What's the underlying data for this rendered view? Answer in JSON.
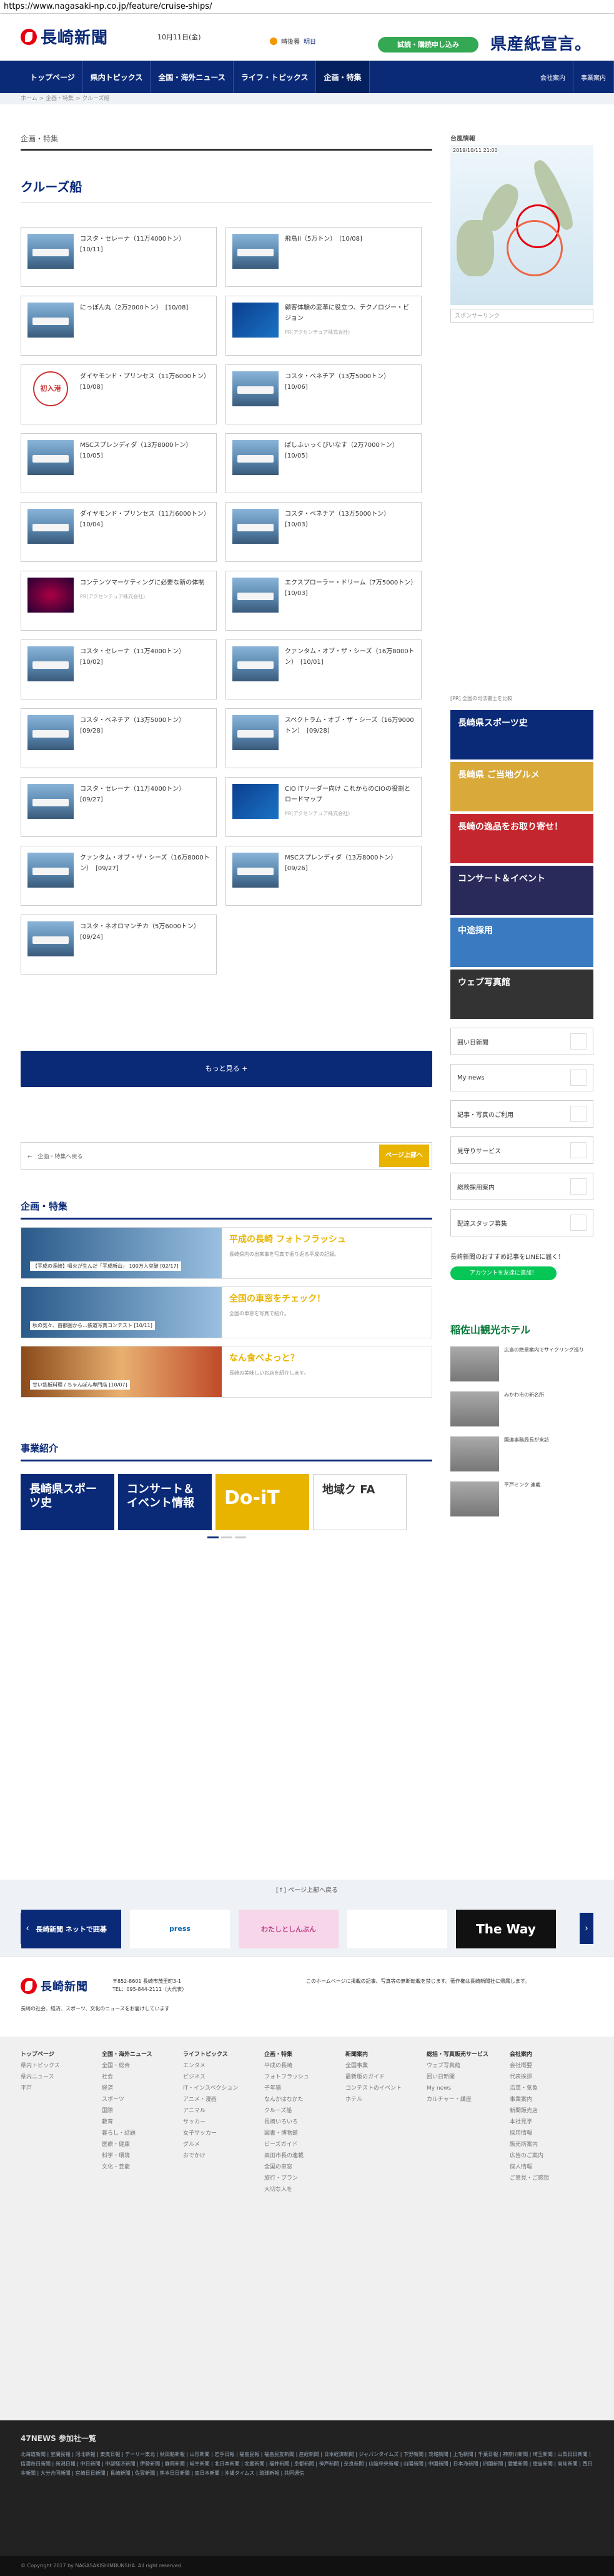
{
  "browser": {
    "url": "https://www.nagasaki-np.co.jp/feature/cruise-ships/"
  },
  "header": {
    "logo": "長崎新聞",
    "date": "10月11日(金)",
    "weather": "晴後曇",
    "weather_link": "明日",
    "trial": "試読・購読申し込み",
    "banner": "県産紙宣言。"
  },
  "nav": {
    "items": [
      "トップページ",
      "県内トピックス",
      "全国・海外ニュース",
      "ライフ・トピックス",
      "企画・特集"
    ],
    "right": [
      "会社案内",
      "事業案内"
    ]
  },
  "breadcrumb": "ホーム > 企画・特集 > クルーズ船",
  "section": "企画・特集",
  "page_title": "クルーズ船",
  "articles": [
    {
      "text": "コスタ・セレーナ（11万4000トン）　[10/11]",
      "type": "ship"
    },
    {
      "text": "飛鳥II（5万トン）　[10/08]",
      "type": "ship"
    },
    {
      "text": "にっぽん丸（2万2000トン）　[10/08]",
      "type": "ship"
    },
    {
      "text": "顧客体験の変革に役立つ、テクノロジー・ビジョン",
      "note": "PR(アクセンチュア株式会社)",
      "type": "tech"
    },
    {
      "text": "ダイヤモンド・プリンセス（11万6000トン）　[10/08]",
      "type": "badge",
      "badge": "初入港"
    },
    {
      "text": "コスタ・ベネチア（13万5000トン）　[10/06]",
      "type": "ship"
    },
    {
      "text": "MSCスプレンディダ（13万8000トン）　[10/05]",
      "type": "ship"
    },
    {
      "text": "ぱしふぃっくびいなす（2万7000トン）　[10/05]",
      "type": "ship"
    },
    {
      "text": "ダイヤモンド・プリンセス（11万6000トン）　[10/04]",
      "type": "ship"
    },
    {
      "text": "コスタ・ベネチア（13万5000トン）　[10/03]",
      "type": "ship"
    },
    {
      "text": "コンテンツマーケティングに必要な新の体制",
      "note": "PR(アクセンチュア株式会社)",
      "type": "night"
    },
    {
      "text": "エクスプローラー・ドリーム（7万5000トン）　[10/03]",
      "type": "ship"
    },
    {
      "text": "コスタ・セレーナ（11万4000トン）　[10/02]",
      "type": "ship"
    },
    {
      "text": "クァンタム・オブ・ザ・シーズ（16万8000トン）　[10/01]",
      "type": "ship"
    },
    {
      "text": "コスタ・ベネチア（13万5000トン）　[09/28]",
      "type": "ship"
    },
    {
      "text": "スペクトラム・オブ・ザ・シーズ（16万9000トン）　[09/28]",
      "type": "ship"
    },
    {
      "text": "コスタ・セレーナ（11万4000トン）　[09/27]",
      "type": "ship"
    },
    {
      "text": "CIO ITリーダー向け これからのCIOの役割とロードマップ",
      "note": "PR(アクセンチュア株式会社)",
      "type": "tech"
    },
    {
      "text": "クァンタム・オブ・ザ・シーズ（16万8000トン）　[09/27]",
      "type": "ship"
    },
    {
      "text": "MSCスプレンディダ（13万8000トン）　[09/26]",
      "type": "ship"
    },
    {
      "text": "コスタ・ネオロマンチカ（5万6000トン）　[09/24]",
      "type": "ship"
    }
  ],
  "more": "もっと見る +",
  "pager": {
    "back": "←　企画・特集へ戻る",
    "next": "ページ上部へ"
  },
  "features_title": "企画・特集",
  "features": [
    {
      "title": "平成の長崎 フォトフラッシュ",
      "caption": "【平成の長崎】噴火が生んだ「平成新山」 100万人突破 [02/17]",
      "desc": "長崎県内の出来事を写真で振り返る平成の記録。",
      "kind": "sea"
    },
    {
      "title": "全国の車窓をチェック！",
      "caption": "秋の気々、首都圏から…鉄道写真コンテスト [10/11]",
      "desc": "全国の車窓を写真で紹介。",
      "kind": "sea"
    },
    {
      "title": "なん食べよっと？",
      "caption": "甘い鉄板料理 / ちゃんぽん専門店 [10/07]",
      "desc": "長崎の美味しいお店を紹介します。",
      "kind": "food"
    }
  ],
  "business_title": "事業紹介",
  "business": [
    "長崎県スポーツ史",
    "コンサート＆イベント情報",
    "Do-iT",
    "地域ク FA"
  ],
  "sidebar": {
    "map_title": "台風情報",
    "map_time": "2019/10/11 21:00",
    "sponsor": "スポンサーリンク",
    "ad_note": "[PR] 全国の司法書士を比較",
    "banners": [
      "長崎県スポーツ史",
      "長崎県 ご当地グルメ",
      "長崎の逸品をお取り寄せ！",
      "コンサート＆イベント",
      "中途採用",
      "ウェブ写真館"
    ],
    "buttons": [
      "囲い日新聞",
      "My news",
      "記事・写真のご利用",
      "見守りサービス",
      "総務採用案内",
      "配達スタッフ募集"
    ],
    "line_text": "長崎新聞のおすすめ記事をLINEに届く！",
    "line_btn": "アカウントを友達に追加！",
    "hotel": "稲佐山観光ホテル",
    "news": [
      "広島の絶景案内でサイクリング巡り",
      "みかわ市の新名所",
      "国連事務局長が来訪",
      "平戸ミンク 連載"
    ]
  },
  "top_link": "[↑] ページ上部へ戻る",
  "partners": [
    "長崎新聞 ネットで囲碁",
    "press",
    "わたしとしんぶん",
    "",
    "The Way"
  ],
  "footer": {
    "logo": "長崎新聞",
    "addr": "〒852-8601 長崎市茂里町3-1\nTEL：095-844-2111（大代表）",
    "note": "このホームページに掲載の記事、写真等の無断転載を禁じます。著作権は長崎新聞社に帰属します。",
    "desc": "長崎の社会、経済、スポーツ、文化のニュースをお届けしています"
  },
  "footer_cols": [
    {
      "hd": "トップページ",
      "items": [
        "県内トピックス",
        "県内ニュース",
        "平戸"
      ]
    },
    {
      "hd": "全国・海外ニュース",
      "items": [
        "全国・総合",
        "社会",
        "経済",
        "スポーツ",
        "国際",
        "教育",
        "暮らし・話題",
        "医療・健康",
        "科学・環境",
        "文化・芸能"
      ]
    },
    {
      "hd": "ライフトピックス",
      "items": [
        "エンタメ",
        "ビジネス",
        "IT・インスペクション",
        "アニメ・漫画",
        "アニマル",
        "サッカー",
        "女子サッカー",
        "グルメ",
        "おでかけ"
      ]
    },
    {
      "hd": "企画・特集",
      "items": [
        "平成の長崎",
        "フォトフラッシュ",
        "子年猫",
        "なんかはなかた",
        "クルーズ船",
        "長崎いろいろ",
        "図書・博物館",
        "ビーズガイド",
        "高田市長の連載",
        "全国の車窓",
        "旅行・プラン",
        "大切な人を"
      ]
    },
    {
      "hd": "新聞案内",
      "items": [
        "全国事業",
        "最新版のガイド",
        "コンテストのイベント",
        "ホテル"
      ]
    },
    {
      "hd": "総括・写真販売サービス",
      "items": [
        "ウェブ写真館",
        "囲い日新聞",
        "My news",
        "カルチャー・講座"
      ]
    },
    {
      "hd": "会社案内",
      "items": [
        "会社概要",
        "代表挨拶",
        "沿革・気象",
        "事業案内",
        "新聞販売店",
        "本社見学",
        "採用情報",
        "販売所案内",
        "広告のご案内",
        "個人情報",
        "ご意見・ご感想"
      ]
    }
  ],
  "site_title": "47NEWS 参加社一覧",
  "sites": "北海道新聞 | 室蘭民報 | 河北新報 | 東奥日報 | デーリー東北 | 秋田魁新報 | 山形新聞 | 岩手日報 | 福島民報 | 福島民友新聞 | 産経新聞 | 日本経済新聞 | ジャパンタイムズ | 下野新聞 | 茨城新聞 | 上毛新聞 | 千葉日報 | 神奈川新聞 | 埼玉新聞 | 山梨日日新聞 | 信濃毎日新聞 | 新潟日報 | 中日新聞 | 中部経済新聞 | 伊勢新聞 | 静岡新聞 | 岐阜新聞 | 北日本新聞 | 北國新聞 | 福井新聞 | 京都新聞 | 神戸新聞 | 奈良新聞 | 山陰中央新報 | 山陽新聞 | 中国新聞 | 日本海新聞 | 四国新聞 | 愛媛新聞 | 徳島新聞 | 高知新聞 | 西日本新聞 | 大分合同新聞 | 宮崎日日新聞 | 長崎新聞 | 佐賀新聞 | 熊本日日新聞 | 南日本新聞 | 沖縄タイムス | 琉球新報 | 共同通信",
  "copyright": "© Copyright 2017 by NAGASAKISHIMBUNSHA. All right reserved."
}
